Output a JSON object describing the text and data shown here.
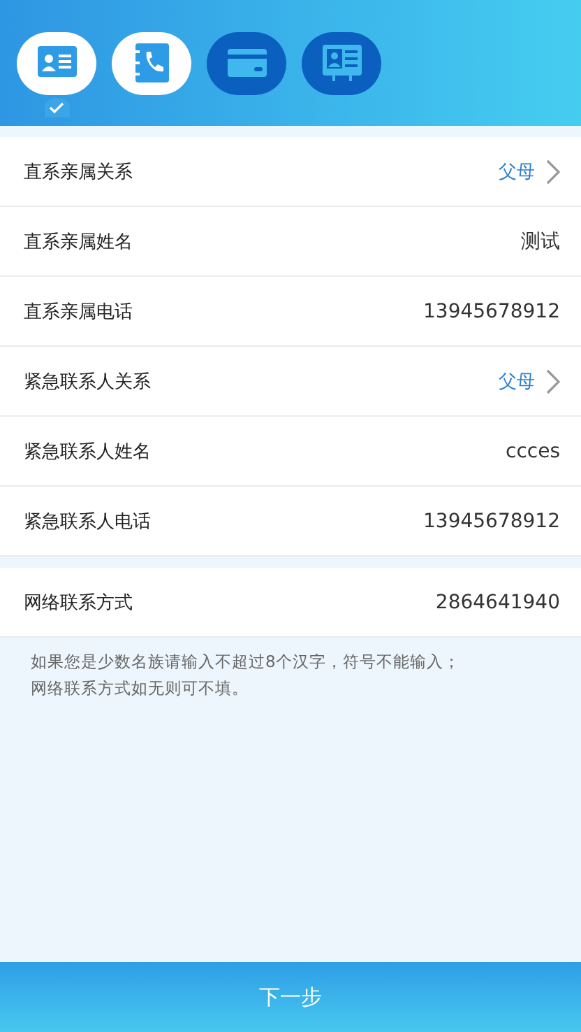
{
  "steps": [
    {
      "kind": "id-card",
      "done": true,
      "selected": true
    },
    {
      "kind": "phone-book",
      "done": true,
      "selected": false
    },
    {
      "kind": "bank-card",
      "done": false,
      "selected": false
    },
    {
      "kind": "profile-card",
      "done": false,
      "selected": false
    }
  ],
  "sections": [
    {
      "rows": [
        {
          "label": "直系亲属关系",
          "value": "父母",
          "kind": "select"
        },
        {
          "label": "直系亲属姓名",
          "value": "测试",
          "kind": "text"
        },
        {
          "label": "直系亲属电话",
          "value": "13945678912",
          "kind": "text"
        },
        {
          "label": "紧急联系人关系",
          "value": "父母",
          "kind": "select"
        },
        {
          "label": "紧急联系人姓名",
          "value": "ccces",
          "kind": "text"
        },
        {
          "label": "紧急联系人电话",
          "value": "13945678912",
          "kind": "text"
        }
      ]
    },
    {
      "rows": [
        {
          "label": "网络联系方式",
          "value": "2864641940",
          "kind": "text"
        }
      ]
    }
  ],
  "note": [
    "如果您是少数名族请输入不超过8个汉字，符号不能输入；",
    "网络联系方式如无则可不填。"
  ],
  "next_button": "下一步"
}
